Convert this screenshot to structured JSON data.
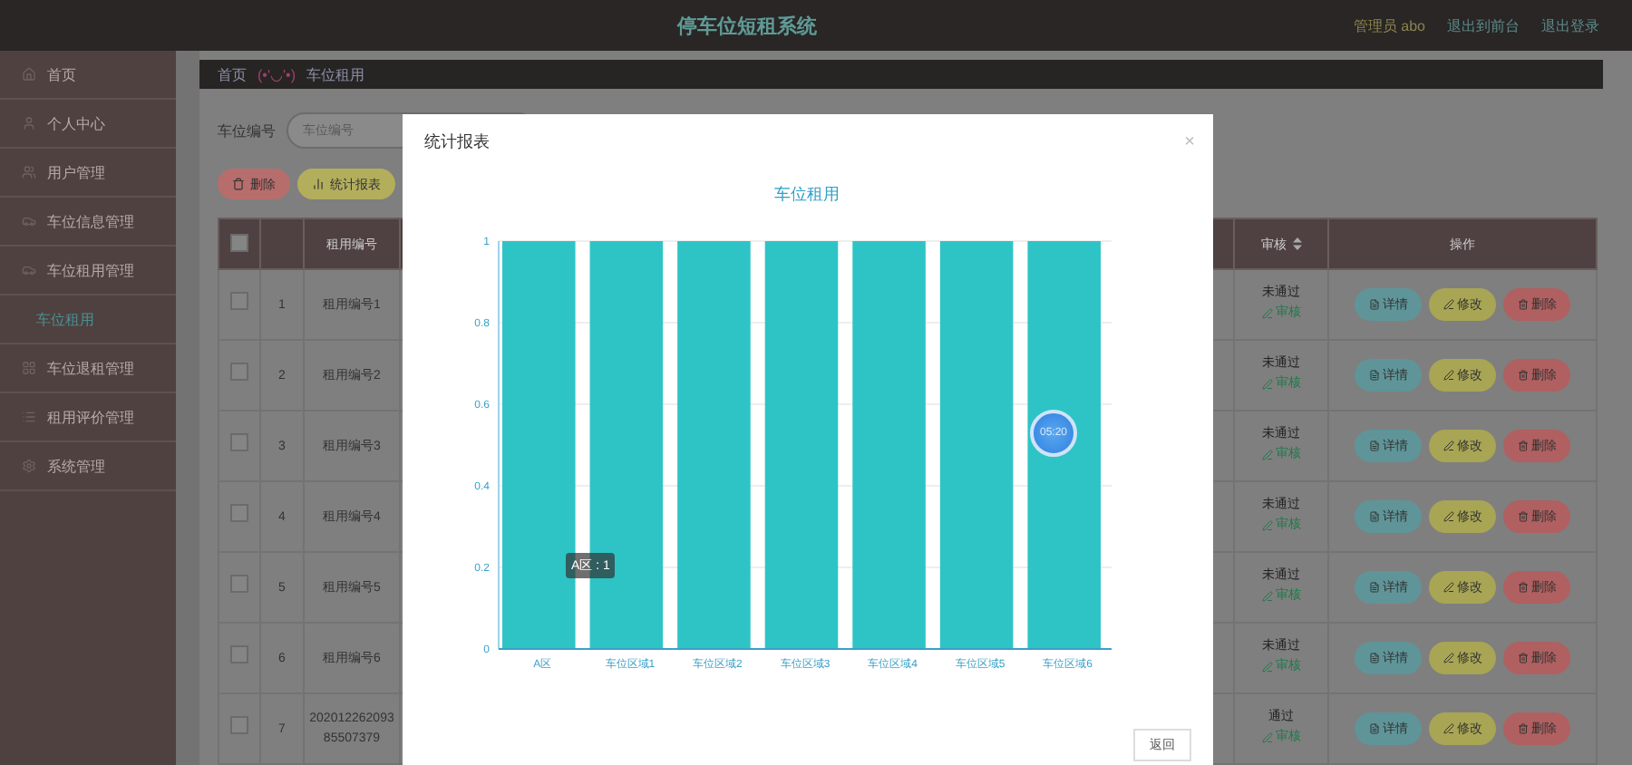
{
  "header": {
    "title": "停车位短租系统",
    "user": "管理员 abo",
    "links": [
      "退出到前台",
      "退出登录"
    ]
  },
  "sidebar": {
    "items": [
      {
        "label": "首页"
      },
      {
        "label": "个人中心"
      },
      {
        "label": "用户管理"
      },
      {
        "label": "车位信息管理"
      },
      {
        "label": "车位租用管理",
        "children": [
          {
            "label": "车位租用",
            "selected": true
          }
        ]
      },
      {
        "label": "车位退租管理"
      },
      {
        "label": "租用评价管理"
      },
      {
        "label": "系统管理"
      }
    ]
  },
  "breadcrumb": [
    "首页",
    "(•'◡'•)",
    "车位租用"
  ],
  "search": {
    "label": "车位编号",
    "placeholder": "车位编号"
  },
  "toolbar": [
    {
      "kind": "delete",
      "label": "删除"
    },
    {
      "kind": "chart",
      "label": "统计报表"
    }
  ],
  "table": {
    "columns": [
      {
        "kind": "checkbox",
        "checked": false
      },
      {
        "kind": "index"
      },
      {
        "kind": "text",
        "label": "租用编号"
      },
      {
        "kind": "hidden"
      },
      {
        "kind": "sort",
        "label": "审核"
      },
      {
        "kind": "text",
        "label": "操作"
      }
    ],
    "rows": [
      {
        "checked": false,
        "index": "1",
        "code": "租用编号1",
        "status": "未通过",
        "review": "审核",
        "actions": [
          {
            "kind": "detail",
            "label": "详情"
          },
          {
            "kind": "edit",
            "label": "修改"
          },
          {
            "kind": "delete",
            "label": "删除"
          }
        ]
      },
      {
        "checked": false,
        "index": "2",
        "code": "租用编号2",
        "status": "未通过",
        "review": "审核",
        "actions": [
          {
            "kind": "detail",
            "label": "详情"
          },
          {
            "kind": "edit",
            "label": "修改"
          },
          {
            "kind": "delete",
            "label": "删除"
          }
        ]
      },
      {
        "checked": false,
        "index": "3",
        "code": "租用编号3",
        "status": "未通过",
        "review": "审核",
        "actions": [
          {
            "kind": "detail",
            "label": "详情"
          },
          {
            "kind": "edit",
            "label": "修改"
          },
          {
            "kind": "delete",
            "label": "删除"
          }
        ]
      },
      {
        "checked": false,
        "index": "4",
        "code": "租用编号4",
        "status": "未通过",
        "review": "审核",
        "actions": [
          {
            "kind": "detail",
            "label": "详情"
          },
          {
            "kind": "edit",
            "label": "修改"
          },
          {
            "kind": "delete",
            "label": "删除"
          }
        ]
      },
      {
        "checked": false,
        "index": "5",
        "code": "租用编号5",
        "status": "未通过",
        "review": "审核",
        "actions": [
          {
            "kind": "detail",
            "label": "详情"
          },
          {
            "kind": "edit",
            "label": "修改"
          },
          {
            "kind": "delete",
            "label": "删除"
          }
        ]
      },
      {
        "checked": false,
        "index": "6",
        "code": "租用编号6",
        "status": "未通过",
        "review": "审核",
        "actions": [
          {
            "kind": "detail",
            "label": "详情"
          },
          {
            "kind": "edit",
            "label": "修改"
          },
          {
            "kind": "delete",
            "label": "删除"
          }
        ]
      },
      {
        "checked": false,
        "index": "7",
        "code": "20201226209385507379",
        "status": "通过",
        "review": "审核",
        "actions": [
          {
            "kind": "detail",
            "label": "详情"
          },
          {
            "kind": "edit",
            "label": "修改"
          },
          {
            "kind": "delete",
            "label": "删除"
          }
        ]
      }
    ]
  },
  "modal": {
    "title": "统计报表",
    "close": "×",
    "chart_data": {
      "type": "bar",
      "title": "车位租用",
      "categories": [
        "A区",
        "车位区域1",
        "车位区域2",
        "车位区域3",
        "车位区域4",
        "车位区域5",
        "车位区域6"
      ],
      "series": [
        {
          "color": "#2ec4c6",
          "values": [
            1,
            1,
            1,
            1,
            1,
            1,
            1
          ]
        }
      ],
      "grid": true,
      "ylim": [
        0,
        1
      ],
      "yticks": [
        0,
        {
          "value": 0.2,
          "label": "0.2"
        },
        {
          "value": 0.4,
          "label": "0.4"
        },
        {
          "value": 0.6,
          "label": "0.6"
        },
        {
          "value": 0.8,
          "label": "0.8"
        },
        1
      ]
    },
    "tooltip": "A区 : 1",
    "timer": "05:20",
    "button": "返回"
  }
}
